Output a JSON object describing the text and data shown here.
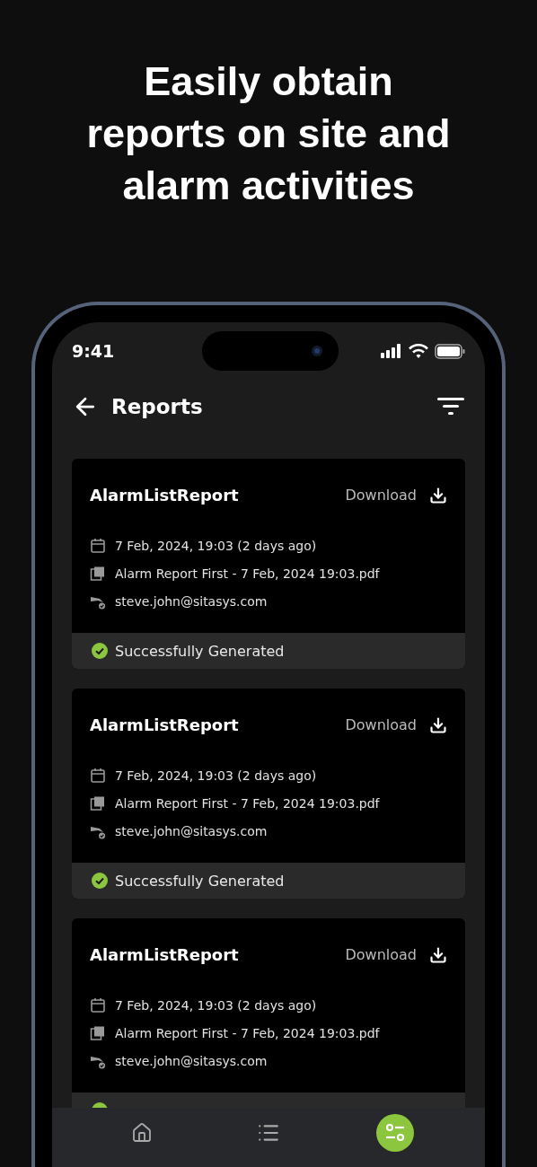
{
  "headline_lines": [
    "Easily obtain",
    "reports on site and",
    "alarm activities"
  ],
  "status_bar": {
    "time": "9:41"
  },
  "header": {
    "title": "Reports"
  },
  "reports": [
    {
      "title": "AlarmListReport",
      "action": "Download",
      "date": "7 Feb, 2024, 19:03 (2 days ago)",
      "file": "Alarm Report First - 7 Feb, 2024 19:03.pdf",
      "email": "steve.john@sitasys.com",
      "status": "Successfully Generated",
      "success": true
    },
    {
      "title": "AlarmListReport",
      "action": "Download",
      "date": "7 Feb, 2024, 19:03 (2 days ago)",
      "file": "Alarm Report First - 7 Feb, 2024 19:03.pdf",
      "email": "steve.john@sitasys.com",
      "status": "Successfully Generated",
      "success": true
    },
    {
      "title": "AlarmListReport",
      "action": "Download",
      "date": "7 Feb, 2024, 19:03 (2 days ago)",
      "file": "Alarm Report First - 7 Feb, 2024 19:03.pdf",
      "email": "steve.john@sitasys.com",
      "success": true
    }
  ],
  "nav": [
    {
      "kind": "home",
      "selected": false
    },
    {
      "kind": "events",
      "selected": false
    },
    {
      "kind": "more",
      "selected": true
    }
  ]
}
